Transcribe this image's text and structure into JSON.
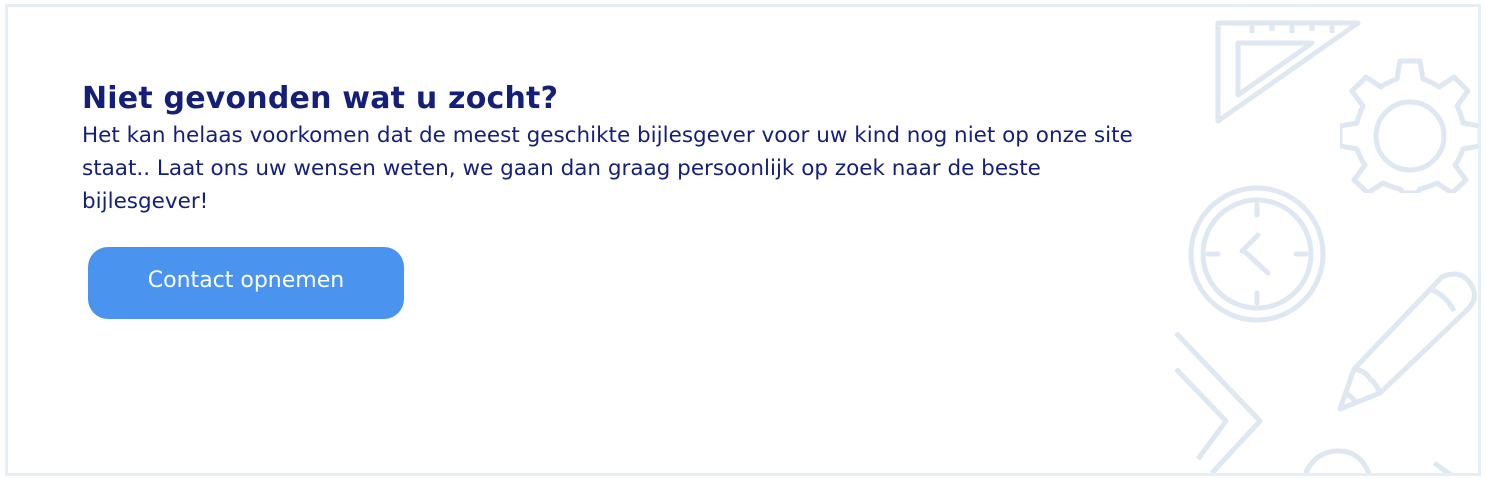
{
  "banner": {
    "title": "Niet gevonden wat u zocht?",
    "body": "Het kan helaas voorkomen dat de meest geschikte bijlesgever voor uw kind nog niet op onze site staat.. Laat ons uw wensen weten, we gaan dan graag persoonlijk op zoek naar de beste bijlesgever!",
    "cta_label": "Contact opnemen"
  },
  "decorations": {
    "icons": [
      "triangle-ruler-icon",
      "gear-icon",
      "clock-icon",
      "pencil-icon",
      "set-square-icon",
      "protractor-icon"
    ],
    "color": "#dfe7f2"
  },
  "colors": {
    "title": "#141f7a",
    "button_background": "#4a94f0",
    "button_text": "#ffffff",
    "border": "#e6eef6"
  }
}
